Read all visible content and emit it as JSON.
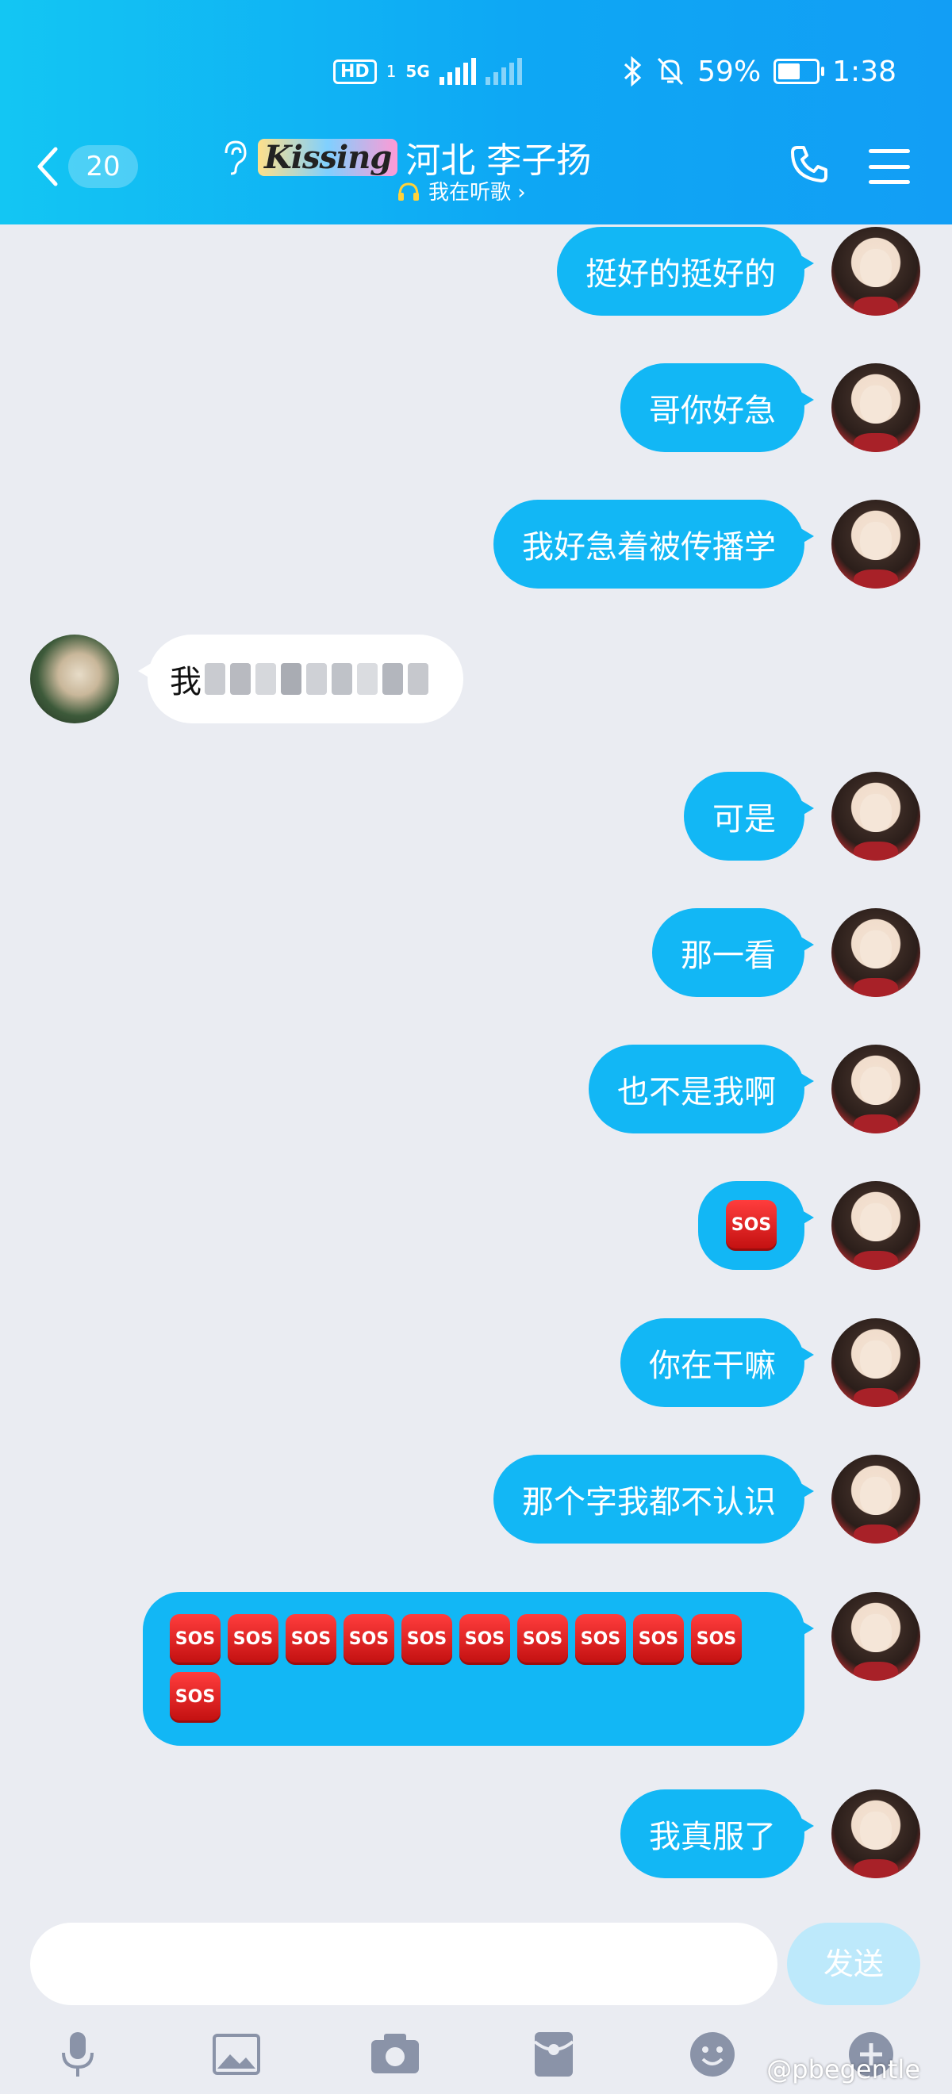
{
  "status_bar": {
    "network_hd": "HD",
    "network_sub": "1",
    "network_gen": "5G",
    "battery_percent": "59%",
    "battery_level": 0.59,
    "time": "1:38"
  },
  "header": {
    "unread_count": "20",
    "logo_text": "Kissing",
    "title": "河北 李子扬",
    "subtitle": "我在听歌 ›",
    "icons": [
      "back-icon",
      "ear-icon",
      "headphone-icon",
      "phone-icon",
      "menu-icon"
    ]
  },
  "messages": [
    {
      "from": "me",
      "text": "挺好的挺好的"
    },
    {
      "from": "me",
      "text": "哥你好急"
    },
    {
      "from": "me",
      "text": "我好急着被传播学"
    },
    {
      "from": "other",
      "text": "我"
    },
    {
      "from": "me",
      "text": "可是"
    },
    {
      "from": "me",
      "text": "那一看"
    },
    {
      "from": "me",
      "text": "也不是我啊"
    },
    {
      "from": "me",
      "emoji": "SOS",
      "count": 1
    },
    {
      "from": "me",
      "text": "你在干嘛"
    },
    {
      "from": "me",
      "text": "那个字我都不认识"
    },
    {
      "from": "me",
      "emoji": "SOS",
      "count": 11
    },
    {
      "from": "me",
      "text": "我真服了"
    }
  ],
  "composer": {
    "send_label": "发送",
    "tools": [
      "microphone-icon",
      "image-icon",
      "camera-icon",
      "red-packet-icon",
      "emoji-icon",
      "plus-icon"
    ]
  },
  "watermark": "@pbegentle",
  "colors": {
    "header_start": "#13c6f3",
    "header_end": "#129ef5",
    "bubble_me": "#12b7f5",
    "bubble_other": "#ffffff",
    "background": "#eaecf2",
    "sos_red": "#e31b1b"
  }
}
